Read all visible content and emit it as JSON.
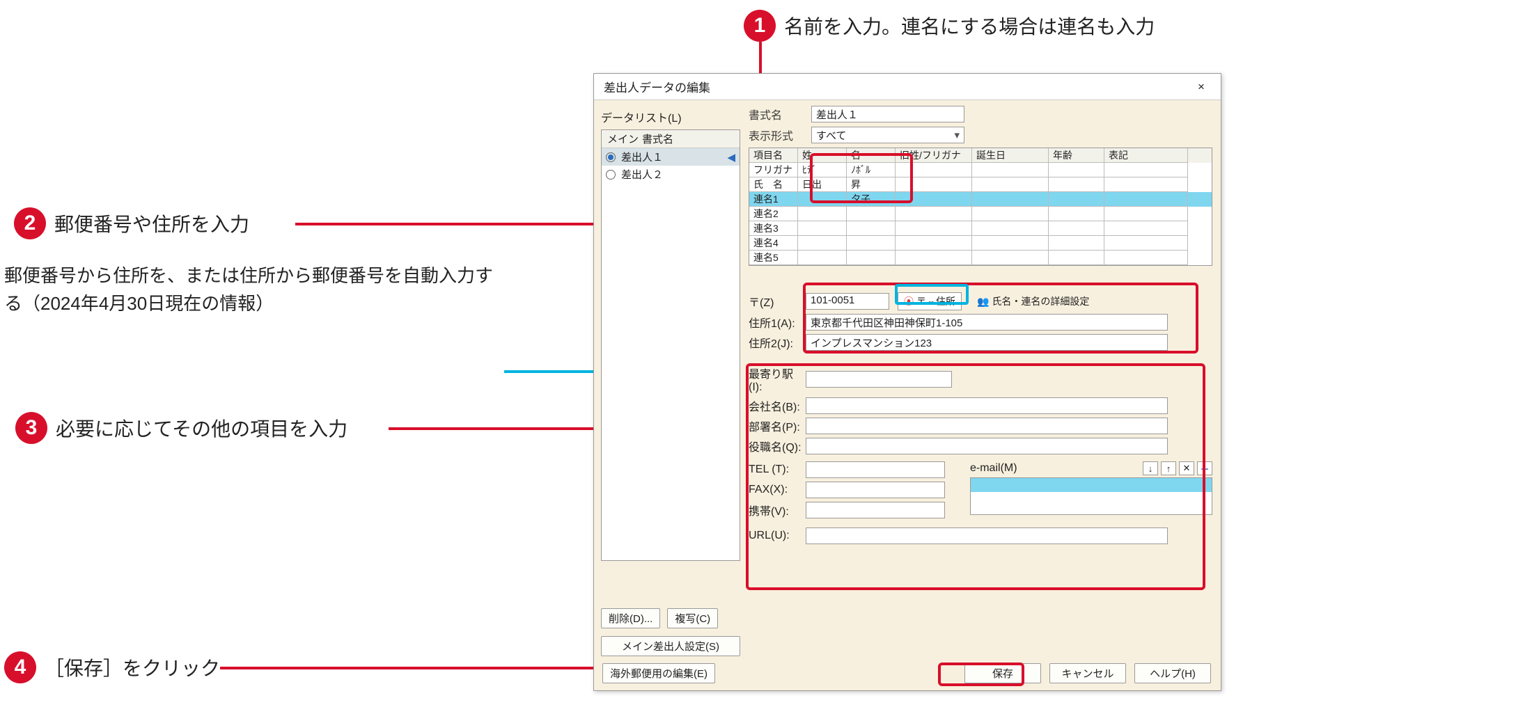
{
  "callouts": {
    "c1": "名前を入力。連名にする場合は連名も入力",
    "c2": "郵便番号や住所を入力",
    "c3": "必要に応じてその他の項目を入力",
    "c4": "［保存］をクリック",
    "note": "郵便番号から住所を、または住所から郵便番号を自動入力する（2024年4月30日現在の情報）"
  },
  "dialog": {
    "title": "差出人データの編集",
    "close": "×",
    "datalist": {
      "label": "データリスト(L)",
      "head_main": "メイン",
      "head_fmt": "書式名",
      "items": [
        {
          "label": "差出人１",
          "selected": true
        },
        {
          "label": "差出人２",
          "selected": false
        }
      ]
    },
    "btns": {
      "delete": "削除(D)...",
      "copy": "複写(C)",
      "set_main": "メイン差出人設定(S)",
      "ov_edit": "海外郵便用の編集(E)",
      "save": "保存",
      "cancel": "キャンセル",
      "help": "ヘルプ(H)"
    },
    "form": {
      "fmt_label": "書式名",
      "fmt_value": "差出人１",
      "disp_label": "表示形式",
      "disp_value": "すべて"
    },
    "grid": {
      "headers": [
        "項目名",
        "姓",
        "名",
        "旧姓/フリガナ",
        "誕生日",
        "年齢",
        "表記"
      ],
      "rows": [
        {
          "c0": "フリガナ",
          "c1": "ﾋﾃﾞ",
          "c2": "ﾉﾎﾞﾙ"
        },
        {
          "c0": "氏　名",
          "c1": "日出",
          "c2": "昇"
        },
        {
          "c0": "連名1",
          "c1": "",
          "c2": "夕子",
          "sel": true
        },
        {
          "c0": "連名2"
        },
        {
          "c0": "連名3"
        },
        {
          "c0": "連名4"
        },
        {
          "c0": "連名5"
        }
      ]
    },
    "addr": {
      "zip_label": "〒(Z)",
      "zip_value": "101-0051",
      "zip_btn": "〒⇔住所",
      "detail_btn": "氏名・連名の詳細設定",
      "a1_label": "住所1(A):",
      "a1_value": "東京都千代田区神田神保町1-105",
      "a2_label": "住所2(J):",
      "a2_value": "インプレスマンション123"
    },
    "detail": {
      "station_label": "最寄り駅(I):",
      "company_label": "会社名(B):",
      "dept_label": "部署名(P):",
      "title_label": "役職名(Q):",
      "tel_label": "TEL (T):",
      "fax_label": "FAX(X):",
      "mobile_label": "携帯(V):",
      "url_label": "URL(U):",
      "email_label": "e-mail(M)"
    }
  }
}
